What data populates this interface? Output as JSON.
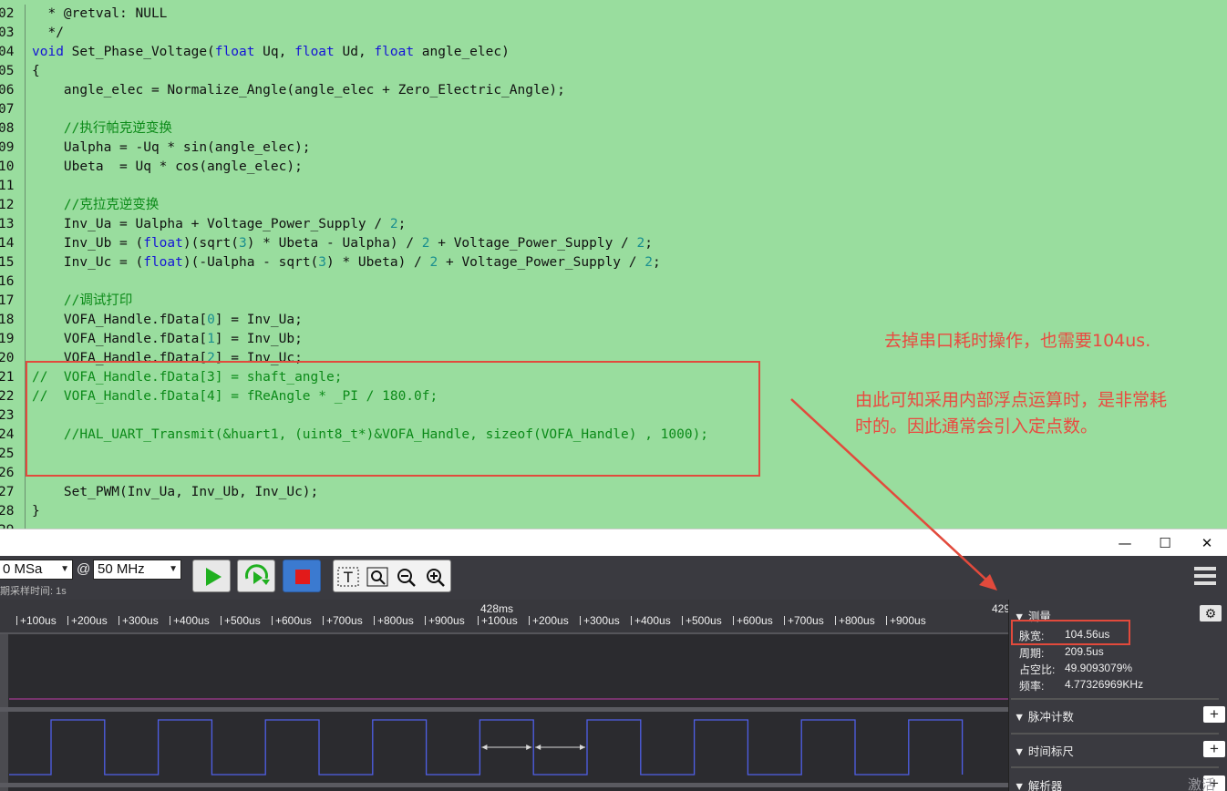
{
  "editor": {
    "lines": [
      {
        "n": "02",
        "t": "  * @retval: NULL"
      },
      {
        "n": "03",
        "t": "  */"
      },
      {
        "n": "04",
        "t": "void Set_Phase_Voltage(float Uq, float Ud, float angle_elec)"
      },
      {
        "n": "05",
        "t": "{"
      },
      {
        "n": "06",
        "t": "    angle_elec = Normalize_Angle(angle_elec + Zero_Electric_Angle);"
      },
      {
        "n": "07",
        "t": ""
      },
      {
        "n": "08",
        "t": "    //执行帕克逆变换"
      },
      {
        "n": "09",
        "t": "    Ualpha = -Uq * sin(angle_elec);"
      },
      {
        "n": "10",
        "t": "    Ubeta  = Uq * cos(angle_elec);"
      },
      {
        "n": "11",
        "t": ""
      },
      {
        "n": "12",
        "t": "    //克拉克逆变换"
      },
      {
        "n": "13",
        "t": "    Inv_Ua = Ualpha + Voltage_Power_Supply / 2;"
      },
      {
        "n": "14",
        "t": "    Inv_Ub = (float)(sqrt(3) * Ubeta - Ualpha) / 2 + Voltage_Power_Supply / 2;"
      },
      {
        "n": "15",
        "t": "    Inv_Uc = (float)(-Ualpha - sqrt(3) * Ubeta) / 2 + Voltage_Power_Supply / 2;"
      },
      {
        "n": "16",
        "t": ""
      },
      {
        "n": "17",
        "t": "    //调试打印"
      },
      {
        "n": "18",
        "t": "    VOFA_Handle.fData[0] = Inv_Ua;"
      },
      {
        "n": "19",
        "t": "    VOFA_Handle.fData[1] = Inv_Ub;"
      },
      {
        "n": "20",
        "t": "    VOFA_Handle.fData[2] = Inv_Uc;"
      },
      {
        "n": "21",
        "t": "//  VOFA_Handle.fData[3] = shaft_angle;"
      },
      {
        "n": "22",
        "t": "//  VOFA_Handle.fData[4] = fReAngle * _PI / 180.0f;"
      },
      {
        "n": "23",
        "t": ""
      },
      {
        "n": "24",
        "t": "    //HAL_UART_Transmit(&huart1, (uint8_t*)&VOFA_Handle, sizeof(VOFA_Handle) , 1000);"
      },
      {
        "n": "25",
        "t": ""
      },
      {
        "n": "26",
        "t": ""
      },
      {
        "n": "27",
        "t": "    Set_PWM(Inv_Ua, Inv_Ub, Inv_Uc);"
      },
      {
        "n": "28",
        "t": "}"
      },
      {
        "n": "29",
        "t": ""
      }
    ]
  },
  "annotations": {
    "note1": "去掉串口耗时操作，也需要104us.",
    "note2_line1": "由此可知采用内部浮点运算时，是非常耗",
    "note2_line2": "时的。因此通常会引入定点数。",
    "accent_color": "#ea4a40"
  },
  "window": {
    "minimize": "—",
    "maximize": "☐",
    "close": "✕"
  },
  "toolbar": {
    "sample_depth": "0 MSa",
    "at": "@",
    "sample_rate": "50 MHz",
    "sample_time_label": "期采样时间: 1s",
    "start_icon": "play-icon",
    "repeat_icon": "repeat-icon",
    "stop_icon": "stop-icon",
    "tool_text": "T",
    "menu_icon": "hamburger-icon"
  },
  "ruler": {
    "major": [
      "428ms",
      "429"
    ],
    "ticks": [
      "+100us",
      "+200us",
      "+300us",
      "+400us",
      "+500us",
      "+600us",
      "+700us",
      "+800us",
      "+900us",
      "+100us",
      "+200us",
      "+300us",
      "+400us",
      "+500us",
      "+600us",
      "+700us",
      "+800us",
      "+900us"
    ]
  },
  "panel": {
    "measure": {
      "title": "测量",
      "pulse_width_label": "脉宽:",
      "pulse_width": "104.56us",
      "period_label": "周期:",
      "period": "209.5us",
      "duty_label": "占空比:",
      "duty": "49.9093079%",
      "freq_label": "频率:",
      "freq": "4.77326969KHz"
    },
    "pulse_count": "脉冲计数",
    "time_ruler": "时间标尺",
    "decoder": "解析器",
    "plus": "+",
    "watermark": "激活"
  }
}
